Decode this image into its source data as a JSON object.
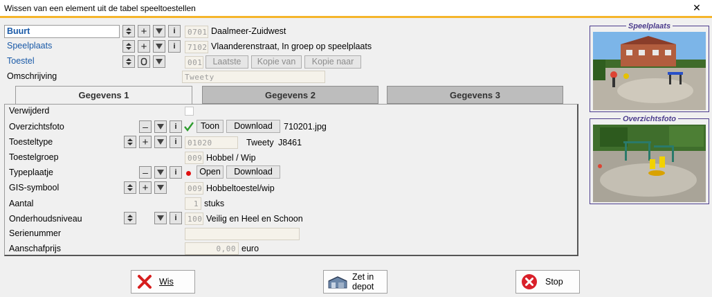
{
  "window": {
    "title": "Wissen van een element uit de tabel speeltoestellen",
    "close_glyph": "✕"
  },
  "header": {
    "buurt": {
      "label": "Buurt",
      "code": "0701",
      "value": "Daalmeer-Zuidwest"
    },
    "speelplaats": {
      "label": "Speelplaats",
      "code": "7102",
      "value": "Vlaanderenstraat, In groep op speelplaats"
    },
    "toestel": {
      "label": "Toestel",
      "code": "001",
      "buttons": [
        "Laatste",
        "Kopie van",
        "Kopie naar"
      ]
    },
    "omschrijving": {
      "label": "Omschrijving",
      "value": "Tweety"
    }
  },
  "tabs": [
    {
      "label": "Gegevens 1",
      "active": true
    },
    {
      "label": "Gegevens 2",
      "active": false
    },
    {
      "label": "Gegevens 3",
      "active": false
    }
  ],
  "fields": {
    "verwijderd": {
      "label": "Verwijderd",
      "checked": false
    },
    "overzichtsfoto": {
      "label": "Overzichtsfoto",
      "show_label": "Toon",
      "download_label": "Download",
      "filename": "710201.jpg"
    },
    "toesteltype": {
      "label": "Toesteltype",
      "code": "01020",
      "name": "Tweety",
      "model": "J8461"
    },
    "toestelgroep": {
      "label": "Toestelgroep",
      "code": "009",
      "value": "Hobbel / Wip"
    },
    "typeplaatje": {
      "label": "Typeplaatje",
      "open_label": "Open",
      "download_label": "Download"
    },
    "gis_symbool": {
      "label": "GIS-symbool",
      "code": "009",
      "value": "Hobbeltoestel/wip"
    },
    "aantal": {
      "label": "Aantal",
      "value": "1",
      "unit": "stuks"
    },
    "onderhoudsniveau": {
      "label": "Onderhoudsniveau",
      "code": "100",
      "value": "Veilig en Heel en Schoon"
    },
    "serienummer": {
      "label": "Serienummer",
      "value": ""
    },
    "aanschafprijs": {
      "label": "Aanschafprijs",
      "value": "0,00",
      "unit": "euro"
    }
  },
  "photos": {
    "speelplaats": {
      "caption": "Speelplaats"
    },
    "overzichtsfoto": {
      "caption": "Overzichtsfoto"
    }
  },
  "actions": {
    "wis": {
      "label": "Wis",
      "icon": "red-x-icon"
    },
    "depot": {
      "label_line1": "Zet in",
      "label_line2": "depot",
      "icon": "depot-building-icon"
    },
    "stop": {
      "label": "Stop",
      "icon": "stop-circle-icon"
    }
  },
  "colors": {
    "accent_bar": "#f5b52a",
    "link_blue": "#1a5aa8",
    "photo_border": "#4b3b8c",
    "check_green": "#2e9c2e",
    "dot_red": "#e01010"
  }
}
